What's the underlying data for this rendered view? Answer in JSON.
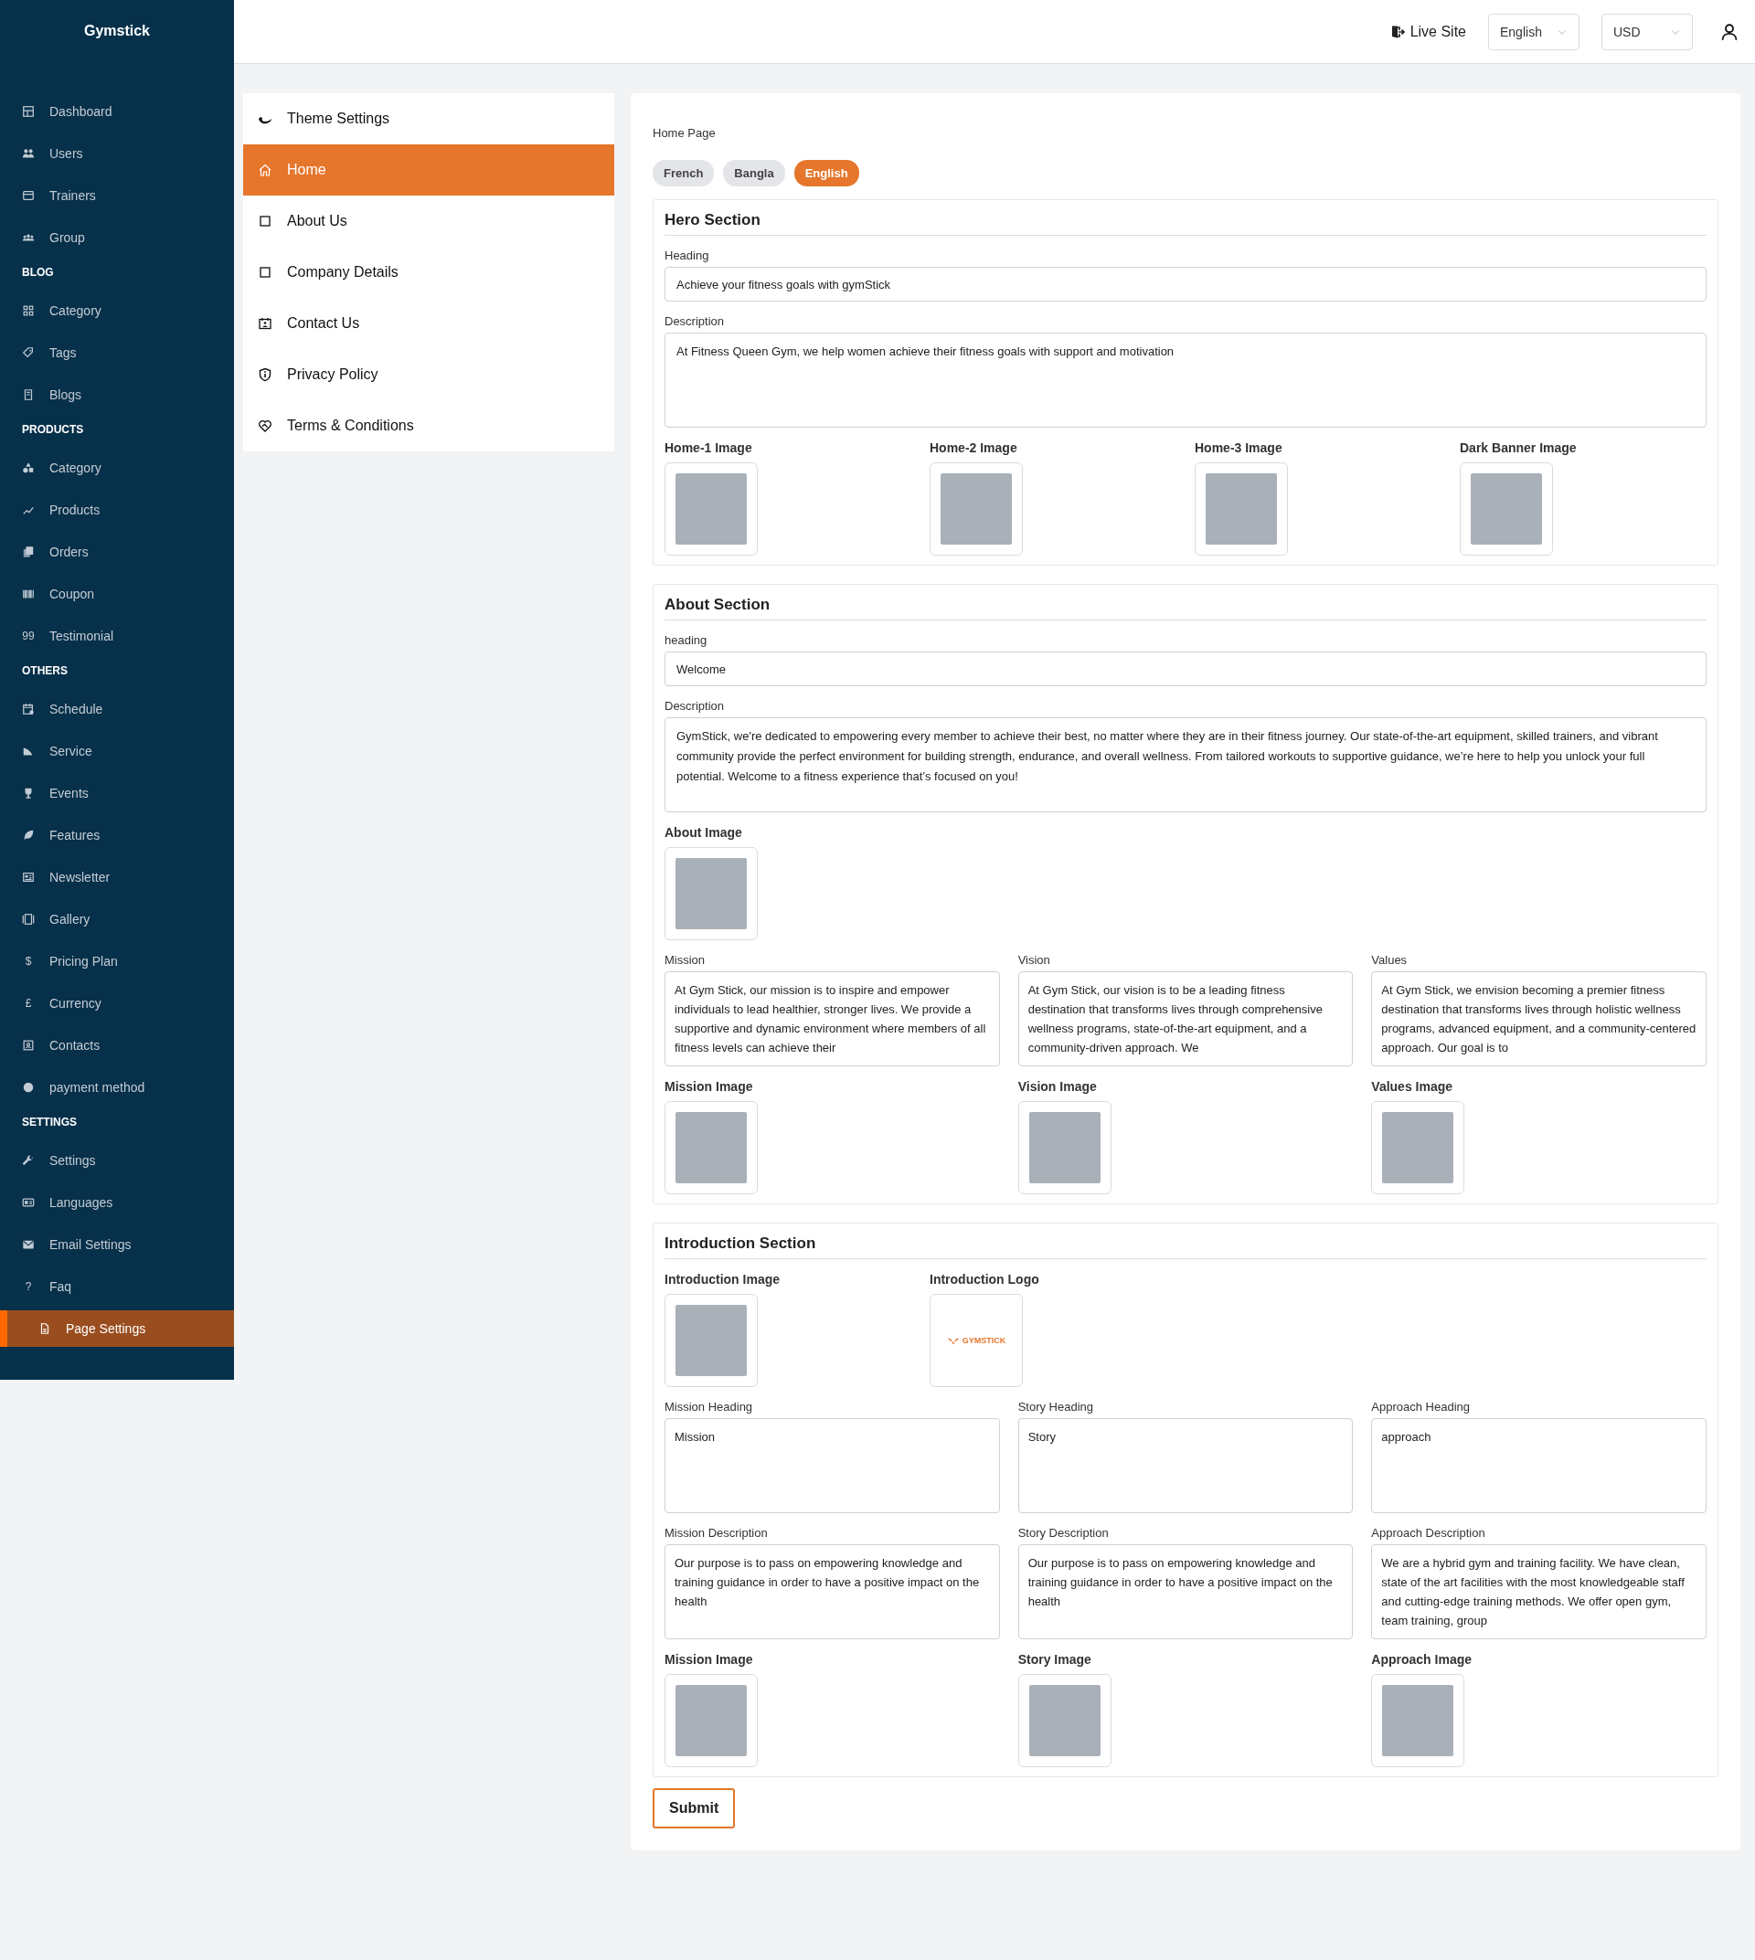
{
  "brand": "Gymstick",
  "sidebar": {
    "groups": [
      {
        "items": [
          {
            "label": "Dashboard",
            "selected": false
          },
          {
            "label": "Users",
            "selected": false
          },
          {
            "label": "Trainers",
            "selected": false
          },
          {
            "label": "Group",
            "selected": false
          }
        ]
      },
      {
        "title": "BLOG",
        "items": [
          {
            "label": "Category",
            "selected": false
          },
          {
            "label": "Tags",
            "selected": false
          },
          {
            "label": "Blogs",
            "selected": false
          }
        ]
      },
      {
        "title": "PRODUCTS",
        "items": [
          {
            "label": "Category",
            "selected": false
          },
          {
            "label": "Products",
            "selected": false
          },
          {
            "label": "Orders",
            "selected": false
          },
          {
            "label": "Coupon",
            "selected": false
          },
          {
            "label": "Testimonial",
            "selected": false,
            "glyph": "99"
          }
        ]
      },
      {
        "title": "OTHERS",
        "items": [
          {
            "label": "Schedule",
            "selected": false
          },
          {
            "label": "Service",
            "selected": false
          },
          {
            "label": "Events",
            "selected": false
          },
          {
            "label": "Features",
            "selected": false
          },
          {
            "label": "Newsletter",
            "selected": false
          },
          {
            "label": "Gallery",
            "selected": false
          },
          {
            "label": "Pricing Plan",
            "selected": false,
            "glyph": "$"
          },
          {
            "label": "Currency",
            "selected": false,
            "glyph": "£"
          },
          {
            "label": "Contacts",
            "selected": false
          },
          {
            "label": "payment method",
            "selected": false
          }
        ]
      },
      {
        "title": "SETTINGS",
        "items": [
          {
            "label": "Settings",
            "selected": false
          },
          {
            "label": "Languages",
            "selected": false
          },
          {
            "label": "Email Settings",
            "selected": false
          },
          {
            "label": "Faq",
            "selected": false,
            "glyph": "?"
          },
          {
            "label": "Page Settings",
            "selected": true
          }
        ]
      }
    ]
  },
  "topbar": {
    "live_site": "Live Site",
    "language": "English",
    "currency": "USD"
  },
  "settings_menu": {
    "title": "Theme Settings",
    "items": [
      {
        "label": "Home",
        "selected": true
      },
      {
        "label": "About Us",
        "selected": false
      },
      {
        "label": "Company Details",
        "selected": false
      },
      {
        "label": "Contact Us",
        "selected": false
      },
      {
        "label": "Privacy Policy",
        "selected": false
      },
      {
        "label": "Terms & Conditions",
        "selected": false
      }
    ]
  },
  "page": {
    "breadcrumb": "Home Page",
    "languages": [
      {
        "label": "French",
        "selected": false
      },
      {
        "label": "Bangla",
        "selected": false
      },
      {
        "label": "English",
        "selected": true
      }
    ],
    "sections": [
      {
        "title": "Hero Section",
        "blocks": [
          {
            "kind": "input",
            "label": "Heading",
            "value": "Achieve your fitness goals with gymStick"
          },
          {
            "kind": "textarea",
            "label": "Description",
            "value": "At Fitness Queen Gym, we help women achieve their fitness goals with support and motivation"
          },
          {
            "kind": "image_grid",
            "items": [
              {
                "label": "Home-1 Image"
              },
              {
                "label": "Home-2 Image"
              },
              {
                "label": "Home-3 Image"
              },
              {
                "label": "Dark Banner Image"
              }
            ]
          }
        ]
      },
      {
        "title": "About Section",
        "blocks": [
          {
            "kind": "input",
            "label": "heading",
            "value": "Welcome"
          },
          {
            "kind": "textarea",
            "label": "Description",
            "value": "GymStick, we're dedicated to empowering every member to achieve their best, no matter where they are in their fitness journey. Our state-of-the-art equipment, skilled trainers, and vibrant community provide the perfect environment for building strength, endurance, and overall wellness. From tailored workouts to supportive guidance, we’re here to help you unlock your full potential. Welcome to a fitness experience that’s focused on you!"
          },
          {
            "kind": "image_grid",
            "items": [
              {
                "label": "About Image"
              }
            ]
          },
          {
            "kind": "text_trio",
            "items": [
              {
                "label": "Mission",
                "value": "At Gym Stick, our mission is to inspire and empower individuals to lead healthier, stronger lives. We provide a supportive and dynamic environment where members of all fitness levels can achieve their"
              },
              {
                "label": "Vision",
                "value": "At Gym Stick, our vision is to be a leading fitness destination that transforms lives through comprehensive wellness programs, state-of-the-art equipment, and a community-driven approach. We"
              },
              {
                "label": "Values",
                "value": "At Gym Stick, we envision becoming a premier fitness destination that transforms lives through holistic wellness programs, advanced equipment, and a community-centered approach. Our goal is to"
              }
            ]
          },
          {
            "kind": "image_trio",
            "items": [
              {
                "label": "Mission Image"
              },
              {
                "label": "Vision Image"
              },
              {
                "label": "Values Image"
              }
            ]
          }
        ]
      },
      {
        "title": "Introduction Section",
        "blocks": [
          {
            "kind": "image_grid",
            "items": [
              {
                "label": "Introduction Image"
              },
              {
                "label": "Introduction Logo",
                "logo": "GYMSTICK"
              }
            ]
          },
          {
            "kind": "text_trio",
            "items": [
              {
                "label": "Mission Heading",
                "value": "Mission"
              },
              {
                "label": "Story Heading",
                "value": "Story"
              },
              {
                "label": "Approach Heading",
                "value": "approach"
              }
            ]
          },
          {
            "kind": "text_trio",
            "items": [
              {
                "label": "Mission Description",
                "value": "Our purpose is to pass on empowering knowledge and training guidance in order to have a positive impact on the health"
              },
              {
                "label": "Story Description",
                "value": "Our purpose is to pass on empowering knowledge and training guidance in order to have a positive impact on the health"
              },
              {
                "label": "Approach Description",
                "value": "We are a hybrid gym and training facility. We have clean, state of the art facilities with the most knowledgeable staff and cutting-edge training methods. We offer open gym, team training, group"
              }
            ]
          },
          {
            "kind": "image_trio",
            "items": [
              {
                "label": "Mission Image"
              },
              {
                "label": "Story Image"
              },
              {
                "label": "Approach Image"
              }
            ]
          }
        ]
      }
    ],
    "submit": "Submit"
  }
}
